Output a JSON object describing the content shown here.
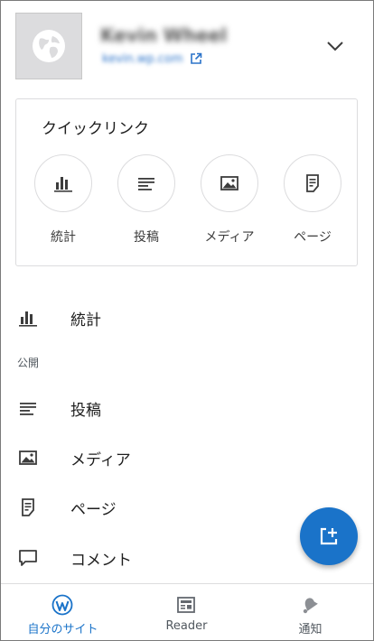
{
  "header": {
    "site_title": "Kevin Wheel",
    "site_url": "kevin.wp.com",
    "icons": {
      "site": "globe-icon",
      "external": "external-link-icon",
      "toggle": "chevron-down-icon"
    }
  },
  "quick_links": {
    "title": "クイックリンク",
    "items": [
      {
        "label": "統計",
        "icon": "stats-icon"
      },
      {
        "label": "投稿",
        "icon": "posts-icon"
      },
      {
        "label": "メディア",
        "icon": "media-icon"
      },
      {
        "label": "ページ",
        "icon": "pages-icon"
      }
    ]
  },
  "menu": {
    "stats_label": "統計",
    "section_publish": "公開",
    "posts_label": "投稿",
    "media_label": "メディア",
    "pages_label": "ページ",
    "comments_label": "コメント"
  },
  "fab": {
    "icon": "new-post-icon"
  },
  "bottom_nav": {
    "my_site": "自分のサイト",
    "reader": "Reader",
    "notifications": "通知"
  },
  "colors": {
    "accent": "#1a73c9",
    "text": "#1e1e1e",
    "muted": "#50575e",
    "border": "#dcdcde"
  }
}
